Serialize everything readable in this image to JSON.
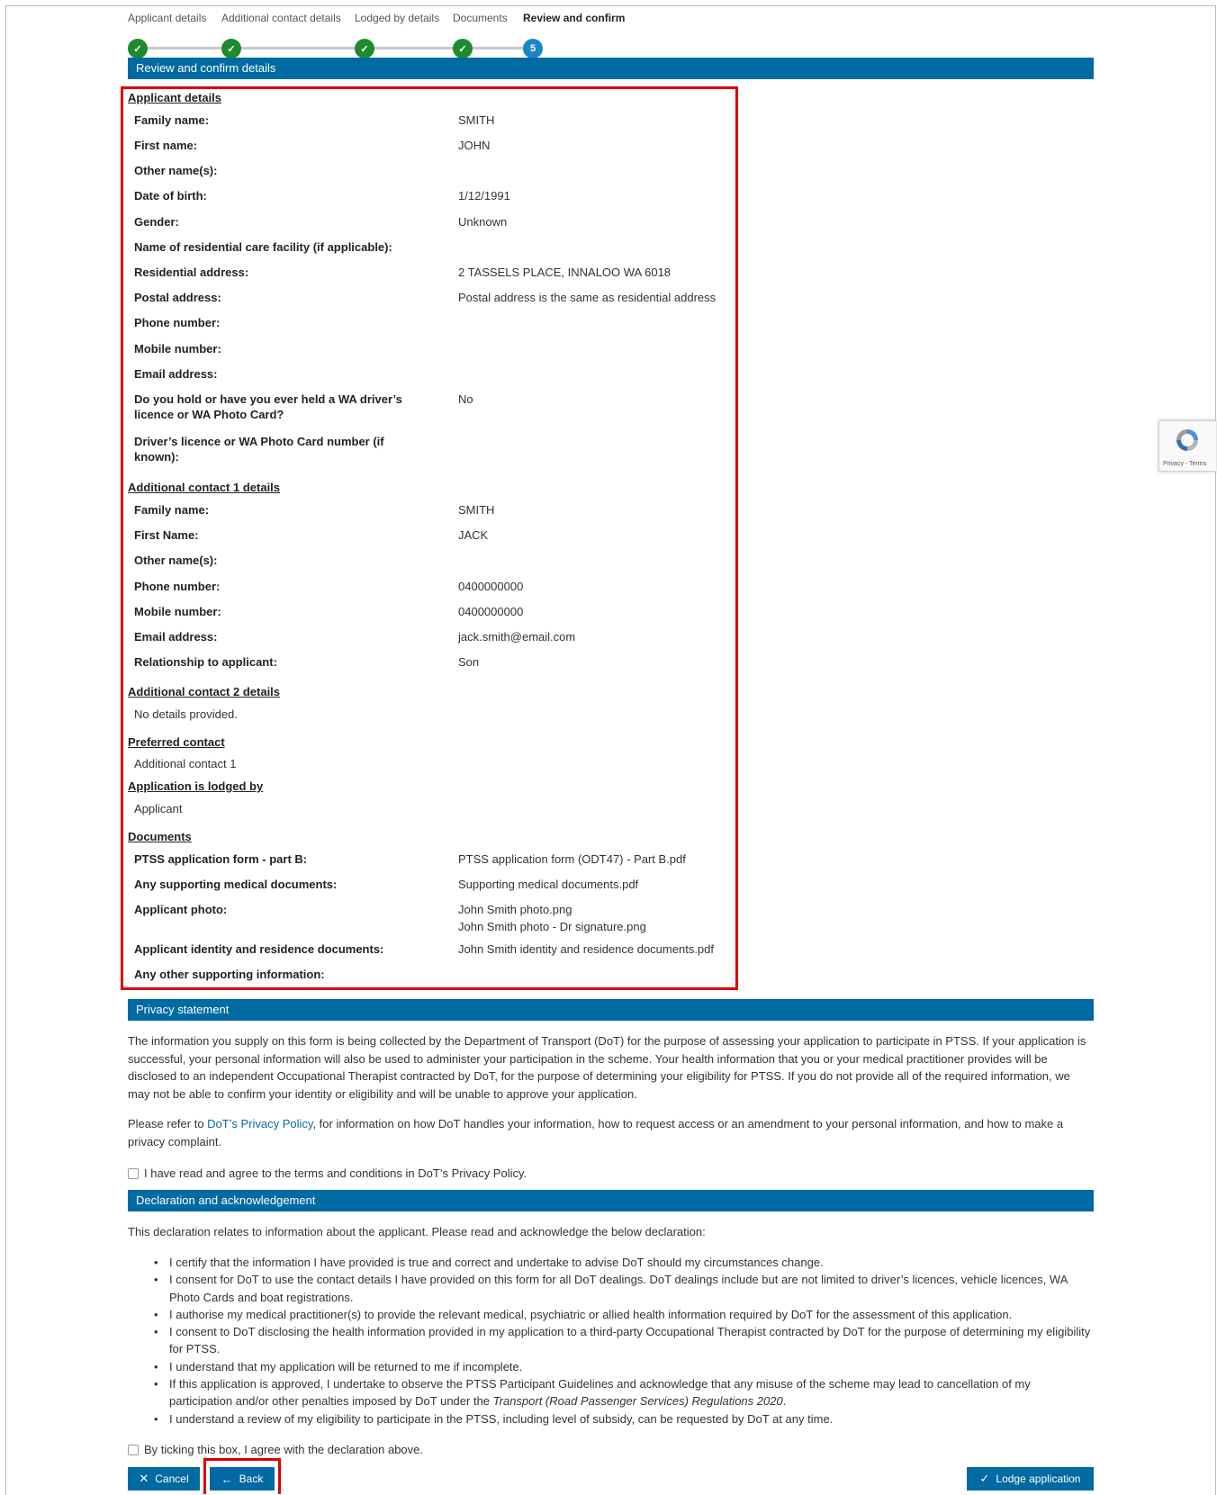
{
  "stepper": {
    "steps": [
      {
        "label": "Applicant details",
        "state": "done"
      },
      {
        "label": "Additional contact details",
        "state": "done"
      },
      {
        "label": "Lodged by details",
        "state": "done"
      },
      {
        "label": "Documents",
        "state": "done"
      },
      {
        "label": "Review and confirm",
        "state": "current",
        "number": "5"
      }
    ]
  },
  "review": {
    "title": "Review and confirm details",
    "applicant": {
      "heading": "Applicant details",
      "rows": [
        {
          "label": "Family name:",
          "value": "SMITH"
        },
        {
          "label": "First name:",
          "value": "JOHN"
        },
        {
          "label": "Other name(s):",
          "value": ""
        },
        {
          "label": "Date of birth:",
          "value": "1/12/1991"
        },
        {
          "label": "Gender:",
          "value": "Unknown"
        },
        {
          "label": "Name of residential care facility (if applicable):",
          "value": ""
        },
        {
          "label": "Residential address:",
          "value": "2 TASSELS PLACE, INNALOO WA 6018"
        },
        {
          "label": "Postal address:",
          "value": "Postal address is the same as residential address"
        },
        {
          "label": "Phone number:",
          "value": ""
        },
        {
          "label": "Mobile number:",
          "value": ""
        },
        {
          "label": "Email address:",
          "value": ""
        },
        {
          "label": "Do you hold or have you ever held a WA driver’s licence or WA Photo Card?",
          "value": "No"
        },
        {
          "label": "Driver’s licence or WA Photo Card number (if known):",
          "value": ""
        }
      ]
    },
    "contact1": {
      "heading": "Additional contact 1 details",
      "rows": [
        {
          "label": "Family name:",
          "value": "SMITH"
        },
        {
          "label": "First Name:",
          "value": "JACK"
        },
        {
          "label": "Other name(s):",
          "value": ""
        },
        {
          "label": "Phone number:",
          "value": "0400000000"
        },
        {
          "label": "Mobile number:",
          "value": "0400000000"
        },
        {
          "label": "Email address:",
          "value": "jack.smith@email.com"
        },
        {
          "label": "Relationship to applicant:",
          "value": "Son"
        }
      ]
    },
    "contact2": {
      "heading": "Additional contact 2 details",
      "text": "No details provided."
    },
    "preferred": {
      "heading": "Preferred contact",
      "text": "Additional contact 1"
    },
    "lodged": {
      "heading": "Application is lodged by",
      "text": "Applicant"
    },
    "documents": {
      "heading": "Documents",
      "rows": [
        {
          "label": "PTSS application form - part B:",
          "value": "PTSS application form (ODT47) - Part B.pdf"
        },
        {
          "label": "Any supporting medical documents:",
          "value": "Supporting medical documents.pdf"
        },
        {
          "label": "Applicant photo:",
          "value": "John Smith photo.png",
          "value2": "John Smith photo - Dr signature.png"
        },
        {
          "label": "Applicant identity and residence documents:",
          "value": "John Smith identity and residence documents.pdf"
        },
        {
          "label": "Any other supporting information:",
          "value": ""
        }
      ]
    }
  },
  "privacy": {
    "title": "Privacy statement",
    "para1": "The information you supply on this form is being collected by the Department of Transport (DoT) for the purpose of assessing your application to participate in PTSS. If your application is successful, your personal information will also be used to administer your participation in the scheme. Your health information that you or your medical practitioner provides will be disclosed to an independent Occupational Therapist contracted by DoT, for the purpose of determining your eligibility for PTSS. If you do not provide all of the required information, we may not be able to confirm your identity or eligibility and will be unable to approve your application.",
    "para2_pre": "Please refer to ",
    "link": "DoT’s Privacy Policy",
    "para2_post": ", for information on how DoT handles your information, how to request access or an amendment to your personal information, and how to make a privacy complaint.",
    "checkbox": "I have read and agree to the terms and conditions in DoT’s Privacy Policy."
  },
  "declaration": {
    "title": "Declaration and acknowledgement",
    "intro": "This declaration relates to information about the applicant. Please read and acknowledge the below declaration:",
    "items": [
      "I certify that the information I have provided is true and correct and undertake to advise DoT should my circumstances change.",
      "I consent for DoT to use the contact details I have provided on this form for all DoT dealings. DoT dealings include but are not limited to driver’s licences, vehicle licences, WA Photo Cards and boat registrations.",
      "I authorise my medical practitioner(s) to provide the relevant medical, psychiatric or allied health information required by DoT for the assessment of this application.",
      "I consent to DoT disclosing the health information provided in my application to a third-party Occupational Therapist contracted by DoT for the purpose of determining my eligibility for PTSS.",
      "I understand that my application will be returned to me if incomplete.",
      "I understand a review of my eligibility to participate in the PTSS, including level of subsidy, can be requested by DoT at any time."
    ],
    "item6_pre": "If this application is approved, I undertake to observe the PTSS Participant Guidelines and acknowledge that any misuse of the scheme may lead to cancellation of my participation and/or other penalties imposed by DoT under the ",
    "item6_italic": "Transport (Road Passenger Services) Regulations 2020",
    "item6_post": ".",
    "checkbox": "By ticking this box, I agree with the declaration above."
  },
  "buttons": {
    "cancel": "Cancel",
    "back": "Back",
    "lodge": "Lodge application"
  },
  "recaptcha": {
    "text": "Privacy - Terms"
  },
  "colors": {
    "primary": "#006aa3",
    "success": "#1f8a2e",
    "current": "#1a86c8",
    "highlight": "#e00000"
  }
}
